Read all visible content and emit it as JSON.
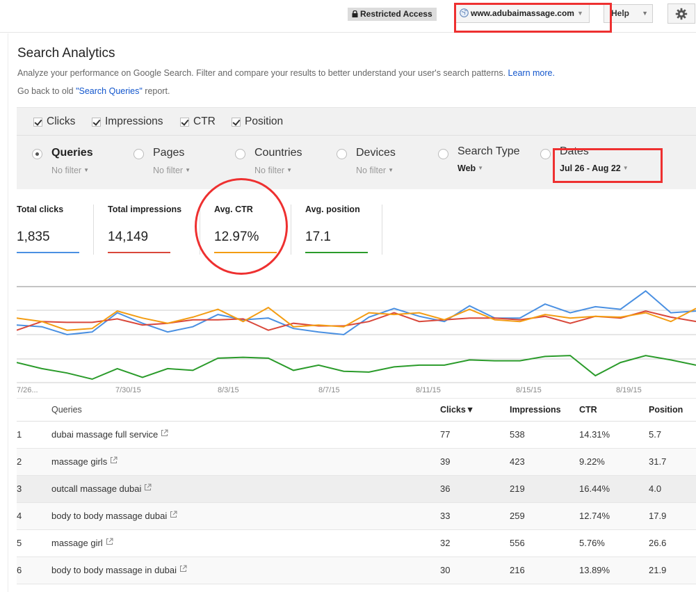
{
  "header": {
    "restricted_label": "Restricted Access",
    "site": "www.adubaimassage.com",
    "help_label": "Help",
    "icons": [
      "lock-icon",
      "globe-icon",
      "gear-icon"
    ]
  },
  "page": {
    "title": "Search Analytics",
    "description": "Analyze your performance on Google Search. Filter and compare your results to better understand your user's search patterns.",
    "learn_more": "Learn more.",
    "old_prefix": "Go back to old ",
    "old_link": "\"Search Queries\"",
    "old_suffix": " report."
  },
  "metrics_checkboxes": [
    {
      "label": "Clicks",
      "checked": true
    },
    {
      "label": "Impressions",
      "checked": true
    },
    {
      "label": "CTR",
      "checked": true
    },
    {
      "label": "Position",
      "checked": true
    }
  ],
  "dimensions": [
    {
      "label": "Queries",
      "filter": "No filter",
      "selected": true
    },
    {
      "label": "Pages",
      "filter": "No filter",
      "selected": false
    },
    {
      "label": "Countries",
      "filter": "No filter",
      "selected": false
    },
    {
      "label": "Devices",
      "filter": "No filter",
      "selected": false
    },
    {
      "label": "Search Type",
      "filter": "Web",
      "selected": false
    },
    {
      "label": "Dates",
      "filter": "Jul 26 - Aug 22",
      "selected": false
    }
  ],
  "summary": [
    {
      "label": "Total clicks",
      "value": "1,835",
      "color": "#4a90e2"
    },
    {
      "label": "Total impressions",
      "value": "14,149",
      "color": "#d9473a"
    },
    {
      "label": "Avg. CTR",
      "value": "12.97%",
      "color": "#f39c12"
    },
    {
      "label": "Avg. position",
      "value": "17.1",
      "color": "#2a9b2a"
    }
  ],
  "chart_data": {
    "type": "line",
    "x_tick_labels": [
      "7/26...",
      "7/30/15",
      "8/3/15",
      "8/7/15",
      "8/11/15",
      "8/15/15",
      "8/19/15"
    ],
    "series": [
      {
        "name": "Clicks",
        "color": "#4a90e2",
        "values": [
          66,
          64,
          55,
          58,
          80,
          68,
          58,
          64,
          78,
          72,
          74,
          62,
          58,
          55,
          75,
          85,
          76,
          70,
          88,
          74,
          74,
          90,
          80,
          87,
          84,
          105,
          80,
          82
        ]
      },
      {
        "name": "Impressions",
        "color": "#d9473a",
        "values": [
          60,
          70,
          69,
          69,
          73,
          66,
          68,
          72,
          72,
          73,
          60,
          68,
          65,
          65,
          70,
          80,
          70,
          72,
          74,
          74,
          72,
          76,
          68,
          76,
          74,
          82,
          75,
          70
        ]
      },
      {
        "name": "CTR",
        "color": "#f39c12",
        "values": [
          74,
          70,
          60,
          62,
          82,
          74,
          68,
          75,
          84,
          70,
          86,
          64,
          66,
          64,
          80,
          78,
          80,
          72,
          84,
          72,
          70,
          78,
          74,
          76,
          75,
          80,
          70,
          85
        ]
      },
      {
        "name": "Position",
        "color": "#2a9b2a",
        "values": [
          23,
          16,
          11,
          4,
          16,
          6,
          16,
          14,
          28,
          29,
          28,
          14,
          20,
          13,
          12,
          18,
          20,
          20,
          26,
          25,
          25,
          30,
          31,
          8,
          23,
          31,
          26,
          20
        ]
      }
    ]
  },
  "table": {
    "columns": [
      "Queries",
      "Clicks▼",
      "Impressions",
      "CTR",
      "Position"
    ],
    "rows": [
      {
        "num": "1",
        "query": "dubai massage full service",
        "clicks": "77",
        "impressions": "538",
        "ctr": "14.31%",
        "position": "5.7"
      },
      {
        "num": "2",
        "query": "massage girls",
        "clicks": "39",
        "impressions": "423",
        "ctr": "9.22%",
        "position": "31.7"
      },
      {
        "num": "3",
        "query": "outcall massage dubai",
        "clicks": "36",
        "impressions": "219",
        "ctr": "16.44%",
        "position": "4.0"
      },
      {
        "num": "4",
        "query": "body to body massage dubai",
        "clicks": "33",
        "impressions": "259",
        "ctr": "12.74%",
        "position": "17.9"
      },
      {
        "num": "5",
        "query": "massage girl",
        "clicks": "32",
        "impressions": "556",
        "ctr": "5.76%",
        "position": "26.6"
      },
      {
        "num": "6",
        "query": "body to body massage in dubai",
        "clicks": "30",
        "impressions": "216",
        "ctr": "13.89%",
        "position": "21.9"
      }
    ]
  }
}
